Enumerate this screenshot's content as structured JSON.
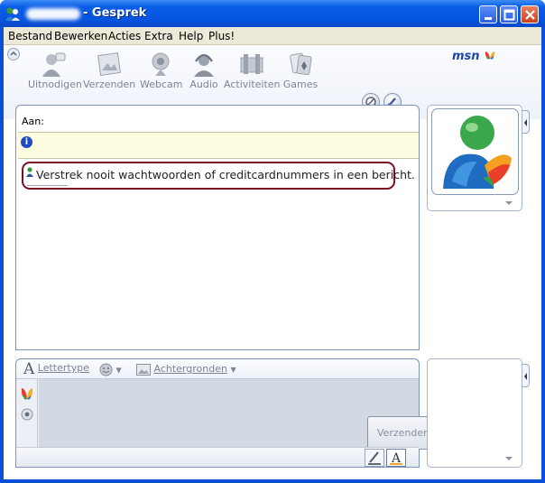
{
  "window": {
    "title": "- Gesprek"
  },
  "menu": [
    "Bestand",
    "Bewerken",
    "Acties",
    "Extra",
    "Help",
    "Plus!"
  ],
  "toolbar": {
    "tools": [
      {
        "label": "Uitnodigen",
        "icon": "invite-contact-icon"
      },
      {
        "label": "Verzenden",
        "icon": "send-files-icon"
      },
      {
        "label": "Webcam",
        "icon": "webcam-icon"
      },
      {
        "label": "Audio",
        "icon": "audio-headset-icon"
      },
      {
        "label": "Activiteiten",
        "icon": "activities-icon"
      },
      {
        "label": "Games",
        "icon": "games-icon"
      }
    ],
    "brand": "msn"
  },
  "chat": {
    "to_label": "Aan:",
    "warning": "Verstrek nooit wachtwoorden of creditcardnummers in een bericht."
  },
  "input": {
    "font_label": "Lettertype",
    "backgrounds_label": "Achtergronden",
    "send_label": "Verzenden"
  },
  "colors": {
    "titlebar": "#0a5de8",
    "warning_outline": "#7a1022",
    "info_bar": "#fdfbe0"
  }
}
